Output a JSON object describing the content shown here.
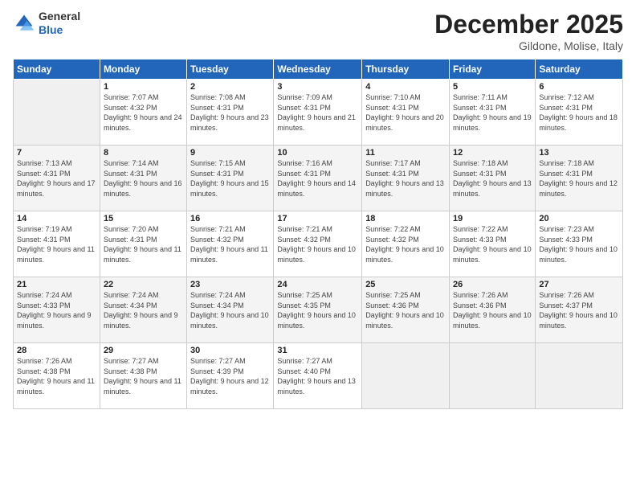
{
  "logo": {
    "general": "General",
    "blue": "Blue"
  },
  "title": "December 2025",
  "subtitle": "Gildone, Molise, Italy",
  "days_header": [
    "Sunday",
    "Monday",
    "Tuesday",
    "Wednesday",
    "Thursday",
    "Friday",
    "Saturday"
  ],
  "weeks": [
    [
      {
        "day": "",
        "sunrise": "",
        "sunset": "",
        "daylight": ""
      },
      {
        "day": "1",
        "sunrise": "Sunrise: 7:07 AM",
        "sunset": "Sunset: 4:32 PM",
        "daylight": "Daylight: 9 hours and 24 minutes."
      },
      {
        "day": "2",
        "sunrise": "Sunrise: 7:08 AM",
        "sunset": "Sunset: 4:31 PM",
        "daylight": "Daylight: 9 hours and 23 minutes."
      },
      {
        "day": "3",
        "sunrise": "Sunrise: 7:09 AM",
        "sunset": "Sunset: 4:31 PM",
        "daylight": "Daylight: 9 hours and 21 minutes."
      },
      {
        "day": "4",
        "sunrise": "Sunrise: 7:10 AM",
        "sunset": "Sunset: 4:31 PM",
        "daylight": "Daylight: 9 hours and 20 minutes."
      },
      {
        "day": "5",
        "sunrise": "Sunrise: 7:11 AM",
        "sunset": "Sunset: 4:31 PM",
        "daylight": "Daylight: 9 hours and 19 minutes."
      },
      {
        "day": "6",
        "sunrise": "Sunrise: 7:12 AM",
        "sunset": "Sunset: 4:31 PM",
        "daylight": "Daylight: 9 hours and 18 minutes."
      }
    ],
    [
      {
        "day": "7",
        "sunrise": "Sunrise: 7:13 AM",
        "sunset": "Sunset: 4:31 PM",
        "daylight": "Daylight: 9 hours and 17 minutes."
      },
      {
        "day": "8",
        "sunrise": "Sunrise: 7:14 AM",
        "sunset": "Sunset: 4:31 PM",
        "daylight": "Daylight: 9 hours and 16 minutes."
      },
      {
        "day": "9",
        "sunrise": "Sunrise: 7:15 AM",
        "sunset": "Sunset: 4:31 PM",
        "daylight": "Daylight: 9 hours and 15 minutes."
      },
      {
        "day": "10",
        "sunrise": "Sunrise: 7:16 AM",
        "sunset": "Sunset: 4:31 PM",
        "daylight": "Daylight: 9 hours and 14 minutes."
      },
      {
        "day": "11",
        "sunrise": "Sunrise: 7:17 AM",
        "sunset": "Sunset: 4:31 PM",
        "daylight": "Daylight: 9 hours and 13 minutes."
      },
      {
        "day": "12",
        "sunrise": "Sunrise: 7:18 AM",
        "sunset": "Sunset: 4:31 PM",
        "daylight": "Daylight: 9 hours and 13 minutes."
      },
      {
        "day": "13",
        "sunrise": "Sunrise: 7:18 AM",
        "sunset": "Sunset: 4:31 PM",
        "daylight": "Daylight: 9 hours and 12 minutes."
      }
    ],
    [
      {
        "day": "14",
        "sunrise": "Sunrise: 7:19 AM",
        "sunset": "Sunset: 4:31 PM",
        "daylight": "Daylight: 9 hours and 11 minutes."
      },
      {
        "day": "15",
        "sunrise": "Sunrise: 7:20 AM",
        "sunset": "Sunset: 4:31 PM",
        "daylight": "Daylight: 9 hours and 11 minutes."
      },
      {
        "day": "16",
        "sunrise": "Sunrise: 7:21 AM",
        "sunset": "Sunset: 4:32 PM",
        "daylight": "Daylight: 9 hours and 11 minutes."
      },
      {
        "day": "17",
        "sunrise": "Sunrise: 7:21 AM",
        "sunset": "Sunset: 4:32 PM",
        "daylight": "Daylight: 9 hours and 10 minutes."
      },
      {
        "day": "18",
        "sunrise": "Sunrise: 7:22 AM",
        "sunset": "Sunset: 4:32 PM",
        "daylight": "Daylight: 9 hours and 10 minutes."
      },
      {
        "day": "19",
        "sunrise": "Sunrise: 7:22 AM",
        "sunset": "Sunset: 4:33 PM",
        "daylight": "Daylight: 9 hours and 10 minutes."
      },
      {
        "day": "20",
        "sunrise": "Sunrise: 7:23 AM",
        "sunset": "Sunset: 4:33 PM",
        "daylight": "Daylight: 9 hours and 10 minutes."
      }
    ],
    [
      {
        "day": "21",
        "sunrise": "Sunrise: 7:24 AM",
        "sunset": "Sunset: 4:33 PM",
        "daylight": "Daylight: 9 hours and 9 minutes."
      },
      {
        "day": "22",
        "sunrise": "Sunrise: 7:24 AM",
        "sunset": "Sunset: 4:34 PM",
        "daylight": "Daylight: 9 hours and 9 minutes."
      },
      {
        "day": "23",
        "sunrise": "Sunrise: 7:24 AM",
        "sunset": "Sunset: 4:34 PM",
        "daylight": "Daylight: 9 hours and 10 minutes."
      },
      {
        "day": "24",
        "sunrise": "Sunrise: 7:25 AM",
        "sunset": "Sunset: 4:35 PM",
        "daylight": "Daylight: 9 hours and 10 minutes."
      },
      {
        "day": "25",
        "sunrise": "Sunrise: 7:25 AM",
        "sunset": "Sunset: 4:36 PM",
        "daylight": "Daylight: 9 hours and 10 minutes."
      },
      {
        "day": "26",
        "sunrise": "Sunrise: 7:26 AM",
        "sunset": "Sunset: 4:36 PM",
        "daylight": "Daylight: 9 hours and 10 minutes."
      },
      {
        "day": "27",
        "sunrise": "Sunrise: 7:26 AM",
        "sunset": "Sunset: 4:37 PM",
        "daylight": "Daylight: 9 hours and 10 minutes."
      }
    ],
    [
      {
        "day": "28",
        "sunrise": "Sunrise: 7:26 AM",
        "sunset": "Sunset: 4:38 PM",
        "daylight": "Daylight: 9 hours and 11 minutes."
      },
      {
        "day": "29",
        "sunrise": "Sunrise: 7:27 AM",
        "sunset": "Sunset: 4:38 PM",
        "daylight": "Daylight: 9 hours and 11 minutes."
      },
      {
        "day": "30",
        "sunrise": "Sunrise: 7:27 AM",
        "sunset": "Sunset: 4:39 PM",
        "daylight": "Daylight: 9 hours and 12 minutes."
      },
      {
        "day": "31",
        "sunrise": "Sunrise: 7:27 AM",
        "sunset": "Sunset: 4:40 PM",
        "daylight": "Daylight: 9 hours and 13 minutes."
      },
      {
        "day": "",
        "sunrise": "",
        "sunset": "",
        "daylight": ""
      },
      {
        "day": "",
        "sunrise": "",
        "sunset": "",
        "daylight": ""
      },
      {
        "day": "",
        "sunrise": "",
        "sunset": "",
        "daylight": ""
      }
    ]
  ]
}
